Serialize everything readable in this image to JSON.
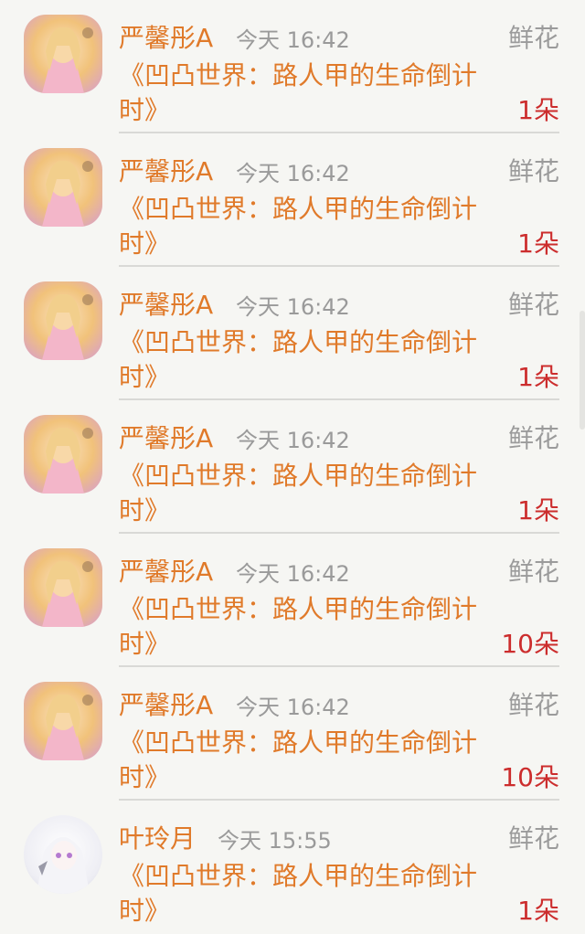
{
  "gift_name": "鲜花",
  "items": [
    {
      "user": "严馨彤A",
      "time": "今天 16:42",
      "book": "《凹凸世界：路人甲的生命倒计时》",
      "count": "1朵",
      "avatar": "anime-girl-pink"
    },
    {
      "user": "严馨彤A",
      "time": "今天 16:42",
      "book": "《凹凸世界：路人甲的生命倒计时》",
      "count": "1朵",
      "avatar": "anime-girl-pink"
    },
    {
      "user": "严馨彤A",
      "time": "今天 16:42",
      "book": "《凹凸世界：路人甲的生命倒计时》",
      "count": "1朵",
      "avatar": "anime-girl-pink"
    },
    {
      "user": "严馨彤A",
      "time": "今天 16:42",
      "book": "《凹凸世界：路人甲的生命倒计时》",
      "count": "1朵",
      "avatar": "anime-girl-pink"
    },
    {
      "user": "严馨彤A",
      "time": "今天 16:42",
      "book": "《凹凸世界：路人甲的生命倒计时》",
      "count": "10朵",
      "avatar": "anime-girl-pink"
    },
    {
      "user": "严馨彤A",
      "time": "今天 16:42",
      "book": "《凹凸世界：路人甲的生命倒计时》",
      "count": "10朵",
      "avatar": "anime-girl-pink"
    },
    {
      "user": "叶玲月",
      "time": "今天 15:55",
      "book": "《凹凸世界：路人甲的生命倒计时》",
      "count": "1朵",
      "avatar": "anime-girl-white"
    }
  ]
}
